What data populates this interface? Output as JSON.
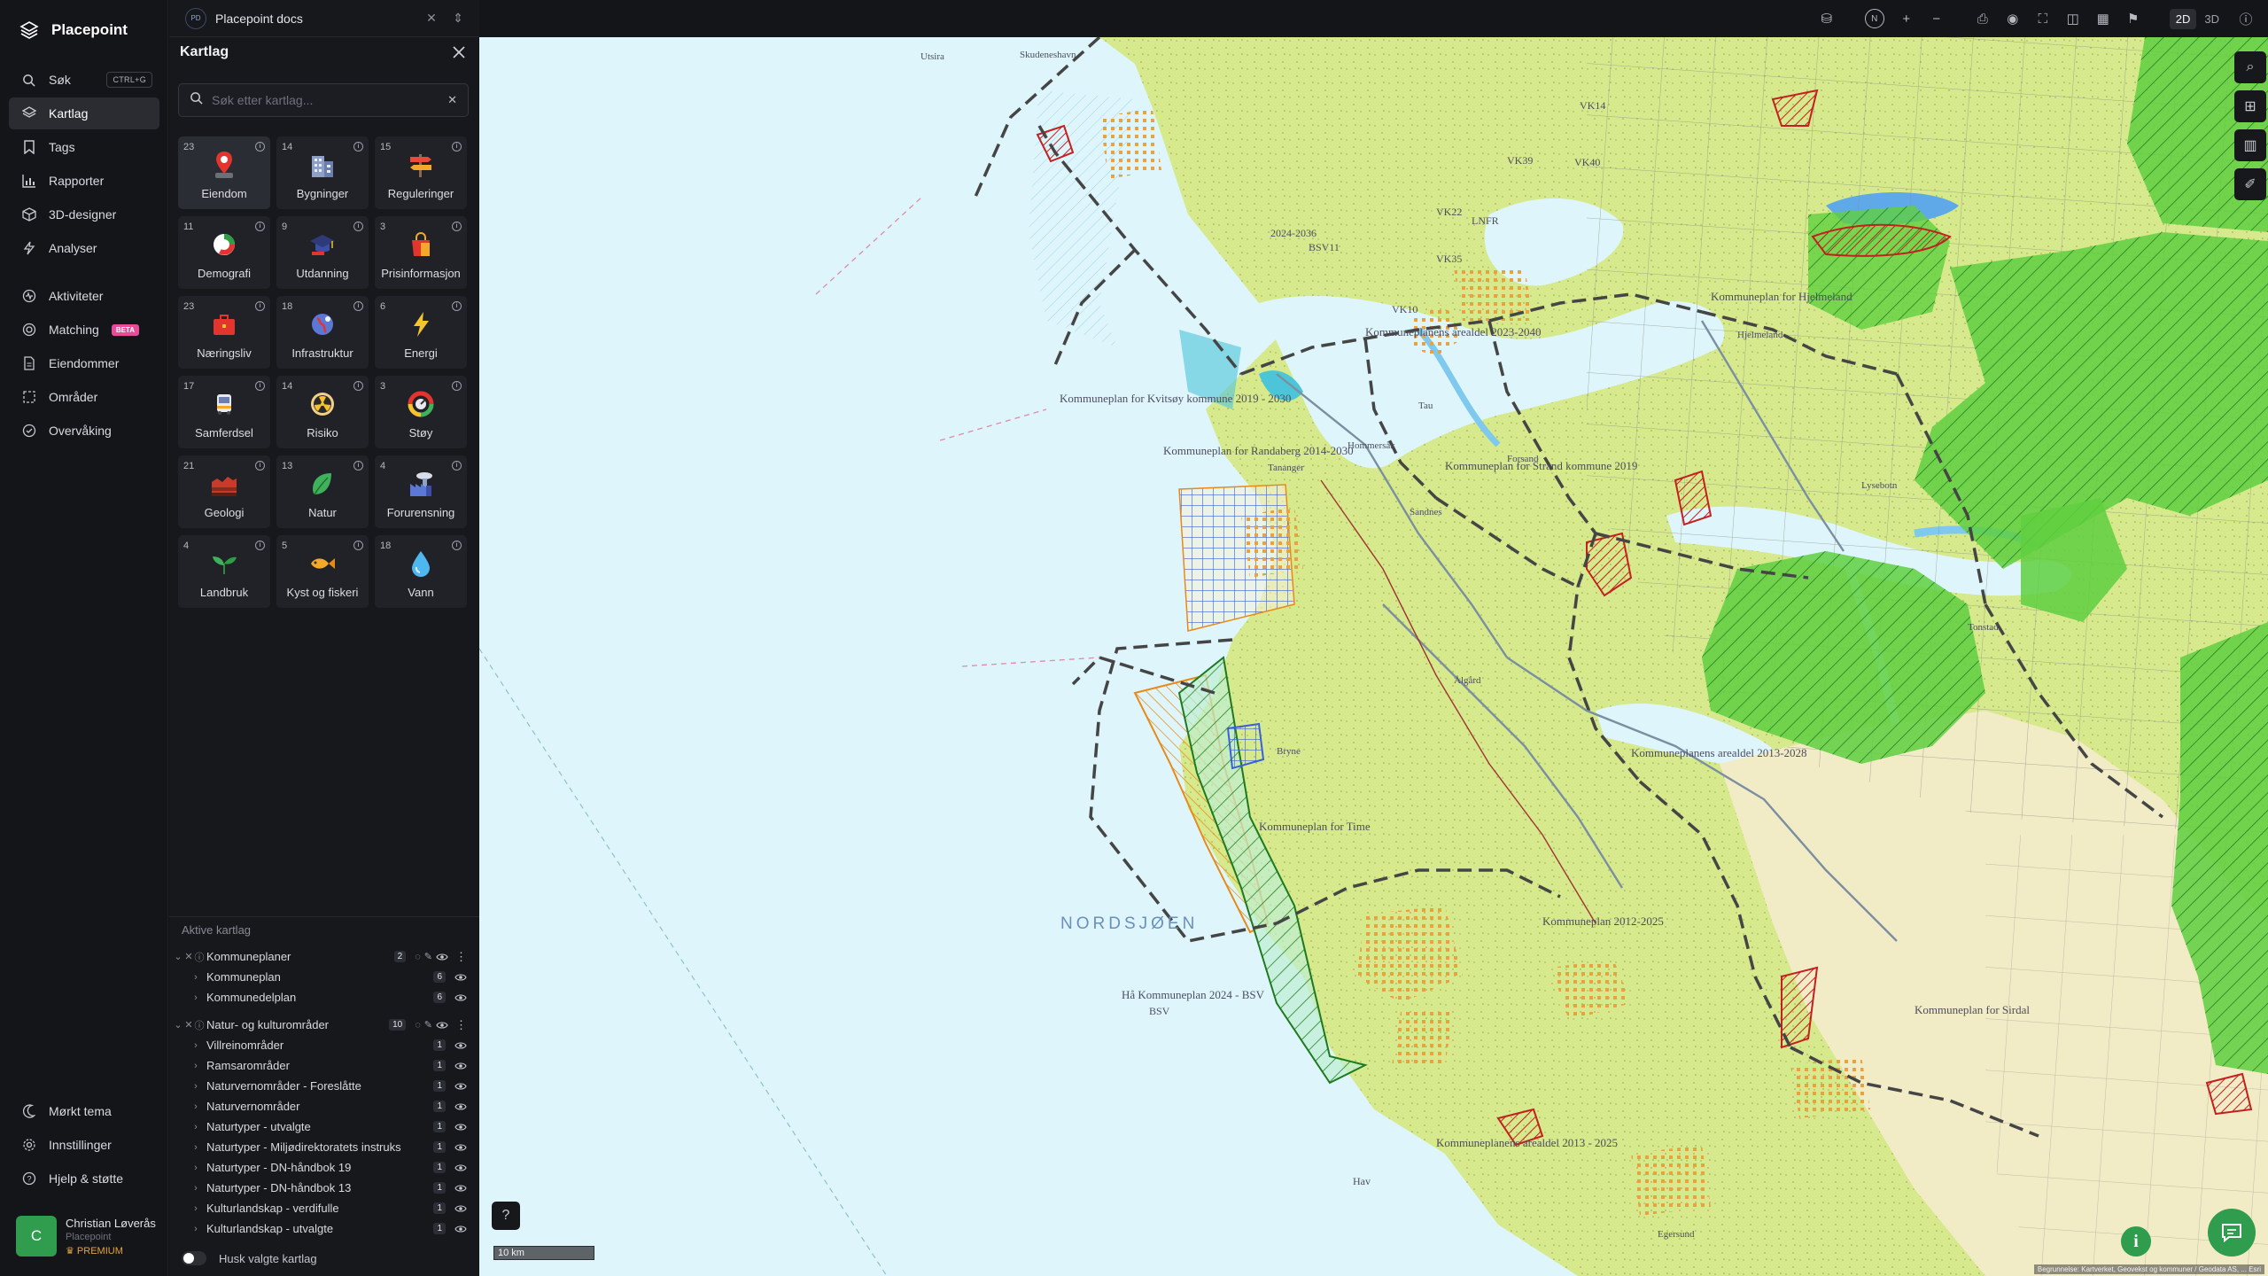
{
  "app": {
    "name": "Placepoint"
  },
  "nav": {
    "items": [
      {
        "label": "Søk",
        "icon": "search-icon",
        "shortcut": "CTRL+G"
      },
      {
        "label": "Kartlag",
        "icon": "layers-icon",
        "active": true
      },
      {
        "label": "Tags",
        "icon": "bookmark-icon"
      },
      {
        "label": "Rapporter",
        "icon": "bar-chart-icon"
      },
      {
        "label": "3D-designer",
        "icon": "cube-icon"
      },
      {
        "label": "Analyser",
        "icon": "bolt-icon"
      },
      {
        "label": "Aktiviteter",
        "icon": "activity-icon"
      },
      {
        "label": "Matching",
        "icon": "target-icon",
        "badge": "BETA"
      },
      {
        "label": "Eiendommer",
        "icon": "document-icon"
      },
      {
        "label": "Områder",
        "icon": "area-icon"
      },
      {
        "label": "Overvåking",
        "icon": "watch-icon"
      }
    ],
    "bottom": [
      {
        "label": "Mørkt tema",
        "icon": "moon-icon"
      },
      {
        "label": "Innstillinger",
        "icon": "gear-icon"
      },
      {
        "label": "Hjelp & støtte",
        "icon": "help-icon"
      }
    ]
  },
  "user": {
    "initial": "C",
    "name": "Christian Løverås",
    "org": "Placepoint",
    "plan": "PREMIUM"
  },
  "doc": {
    "badge": "PD",
    "name": "Placepoint docs"
  },
  "panel": {
    "title": "Kartlag",
    "search_placeholder": "Søk etter kartlag...",
    "categories": [
      {
        "label": "Eiendom",
        "count": "23",
        "icon": "property-pin-icon",
        "active": true
      },
      {
        "label": "Bygninger",
        "count": "14",
        "icon": "buildings-icon"
      },
      {
        "label": "Reguleringer",
        "count": "15",
        "icon": "signpost-icon"
      },
      {
        "label": "Demografi",
        "count": "11",
        "icon": "demographics-icon"
      },
      {
        "label": "Utdanning",
        "count": "9",
        "icon": "graduation-cap-icon"
      },
      {
        "label": "Prisinformasjon",
        "count": "3",
        "icon": "shopping-bag-icon"
      },
      {
        "label": "Næringsliv",
        "count": "23",
        "icon": "briefcase-icon"
      },
      {
        "label": "Infrastruktur",
        "count": "18",
        "icon": "globe-icon"
      },
      {
        "label": "Energi",
        "count": "6",
        "icon": "lightning-icon"
      },
      {
        "label": "Samferdsel",
        "count": "17",
        "icon": "bus-icon"
      },
      {
        "label": "Risiko",
        "count": "14",
        "icon": "radiation-icon"
      },
      {
        "label": "Støy",
        "count": "3",
        "icon": "noise-icon"
      },
      {
        "label": "Geologi",
        "count": "21",
        "icon": "rock-layers-icon"
      },
      {
        "label": "Natur",
        "count": "13",
        "icon": "leaf-icon"
      },
      {
        "label": "Forurensning",
        "count": "4",
        "icon": "factory-icon"
      },
      {
        "label": "Landbruk",
        "count": "4",
        "icon": "sprout-icon"
      },
      {
        "label": "Kyst og fiskeri",
        "count": "5",
        "icon": "fish-icon"
      },
      {
        "label": "Vann",
        "count": "18",
        "icon": "water-drop-icon"
      }
    ],
    "active_heading": "Aktive kartlag",
    "groups": [
      {
        "label": "Kommuneplaner",
        "count": "2",
        "children": [
          {
            "label": "Kommuneplan",
            "count": "6"
          },
          {
            "label": "Kommunedelplan",
            "count": "6"
          }
        ]
      },
      {
        "label": "Natur- og kulturområder",
        "count": "10",
        "children": [
          {
            "label": "Villreinområder",
            "count": "1"
          },
          {
            "label": "Ramsarområder",
            "count": "1"
          },
          {
            "label": "Naturvernområder - Foreslåtte",
            "count": "1"
          },
          {
            "label": "Naturvernområder",
            "count": "1"
          },
          {
            "label": "Naturtyper - utvalgte",
            "count": "1"
          },
          {
            "label": "Naturtyper - Miljødirektoratets instruks",
            "count": "1"
          },
          {
            "label": "Naturtyper - DN-håndbok 19",
            "count": "1"
          },
          {
            "label": "Naturtyper - DN-håndbok 13",
            "count": "1"
          },
          {
            "label": "Kulturlandskap - verdifulle",
            "count": "1"
          },
          {
            "label": "Kulturlandskap - utvalgte",
            "count": "1"
          }
        ]
      }
    ],
    "remember_label": "Husk valgte kartlag"
  },
  "toolbar": {
    "compass": "N",
    "view_modes": [
      "2D",
      "3D"
    ],
    "active_mode": "2D"
  },
  "map": {
    "sea_label": "NORDSJØEN",
    "scale_label": "10 km",
    "attribution": "Begrunnelse: Kartverket, Geovekst og kommuner / Geodata AS, ... Esri",
    "labels": [
      "Kommuneplan for Kvitsøy kommune 2019 - 2030",
      "Kommuneplan for Randaberg 2014-2030",
      "Kommuneplan for Strand kommune 2019",
      "Kommuneplanens arealdel 2023-2040",
      "Kommuneplan for Hjelmeland",
      "Kommuneplanens arealdel 2013-2028",
      "Kommuneplan 2012-2025",
      "Hå Kommuneplan 2024 - BSV",
      "Kommuneplanens arealdel 2013 - 2025",
      "Kommuneplan for Time",
      "Kommuneplan for Sirdal",
      "Utsira",
      "Skudeneshavn",
      "Tananger",
      "Hjelmeland",
      "Tau",
      "Ålgård",
      "Sandnes",
      "Bryne",
      "Egersund",
      "Tonstad",
      "Lysebotn",
      "Forsand",
      "Hommersåk",
      "LNFR",
      "VK10",
      "VK22",
      "VK35",
      "VK39",
      "VK40",
      "VK14",
      "BSV11",
      "BSV",
      "Hav",
      "2024-2036"
    ],
    "colors": {
      "sea": "#def6fb",
      "land": "#d6e98c",
      "forest_green": "#5fcf3f",
      "boundary": "#444444",
      "hatch_red": "#c42020",
      "hatch_orange": "#e88a1a",
      "water": "#7fc8ee"
    }
  }
}
